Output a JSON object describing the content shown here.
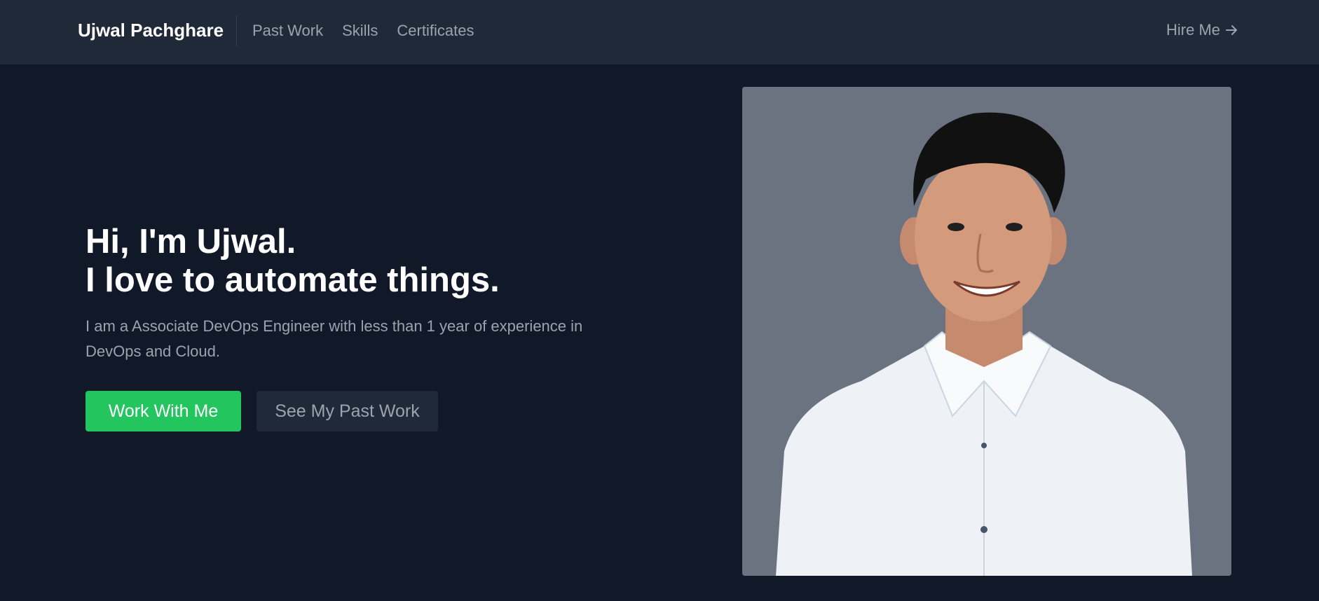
{
  "nav": {
    "brand": "Ujwal Pachghare",
    "links": [
      "Past Work",
      "Skills",
      "Certificates"
    ],
    "hire_me": "Hire Me"
  },
  "hero": {
    "headline_line1": "Hi, I'm Ujwal.",
    "headline_line2": "I love to automate things.",
    "subtitle": "I am a Associate DevOps Engineer with less than 1 year of experience in DevOps and Cloud.",
    "primary_button": "Work With Me",
    "secondary_button": "See My Past Work"
  },
  "colors": {
    "page_bg": "#111827",
    "nav_bg": "#1f2937",
    "accent_green": "#22c55e",
    "muted_text": "#9ca3af",
    "photo_bg": "#6b7280"
  },
  "icons": {
    "hire_me_arrow": "arrow-right-icon"
  }
}
